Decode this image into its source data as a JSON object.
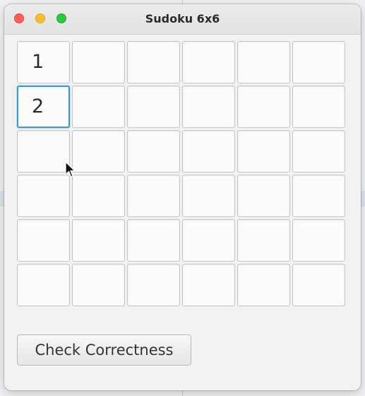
{
  "window": {
    "title": "Sudoku 6x6"
  },
  "grid": {
    "rows": [
      [
        "1",
        "",
        "",
        "",
        "",
        ""
      ],
      [
        "2",
        "",
        "",
        "",
        "",
        ""
      ],
      [
        "",
        "",
        "",
        "",
        "",
        ""
      ],
      [
        "",
        "",
        "",
        "",
        "",
        ""
      ],
      [
        "",
        "",
        "",
        "",
        "",
        ""
      ],
      [
        "",
        "",
        "",
        "",
        "",
        ""
      ]
    ],
    "focused_cell": "r2c1"
  },
  "actions": {
    "check_label": "Check Correctness"
  },
  "colors": {
    "focus_ring": "#3b99d8",
    "close": "#ff5f57",
    "minimize": "#febc2e",
    "maximize": "#28c840"
  }
}
